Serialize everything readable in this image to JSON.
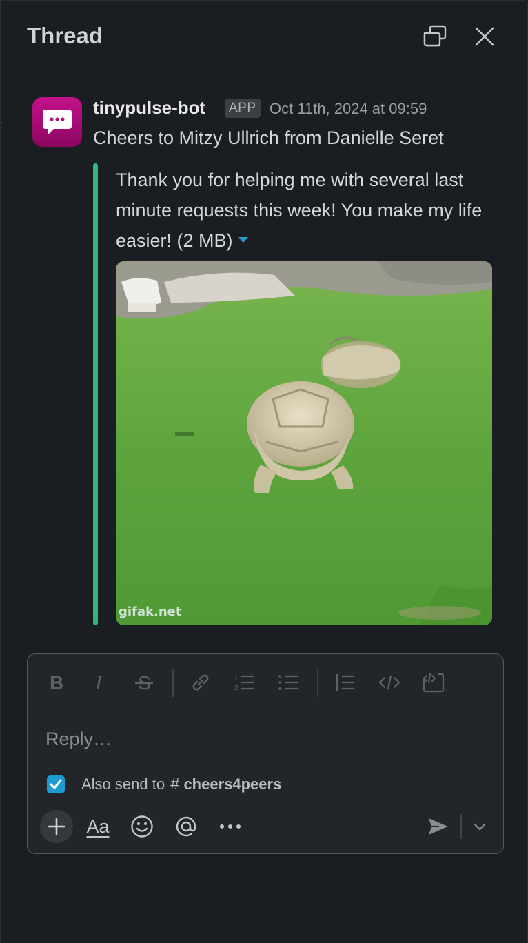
{
  "header": {
    "title": "Thread"
  },
  "message": {
    "sender": "tinypulse-bot",
    "badge": "APP",
    "timestamp": "Oct 11th, 2024 at 09:59",
    "text": "Cheers to Mitzy Ullrich from Danielle Seret",
    "attachment_text": "Thank you for helping me with several last minute requests this week! You make my life easier! (2 MB)",
    "gif_watermark": "gifak.net",
    "accent_color": "#2eb67d"
  },
  "composer": {
    "placeholder": "Reply…",
    "also_send_label": "Also send to",
    "also_send_hash": "#",
    "also_send_channel": "cheers4peers",
    "also_send_checked": true,
    "format_label": "Aa"
  },
  "icons": {
    "header": [
      "open-in-window-icon",
      "close-icon"
    ],
    "format": [
      "bold-icon",
      "italic-icon",
      "strikethrough-icon",
      "link-icon",
      "ordered-list-icon",
      "bulleted-list-icon",
      "blockquote-icon",
      "code-icon",
      "code-block-icon"
    ],
    "actions": [
      "plus-icon",
      "emoji-icon",
      "mention-icon",
      "more-icon",
      "send-icon",
      "chevron-down-icon"
    ]
  }
}
